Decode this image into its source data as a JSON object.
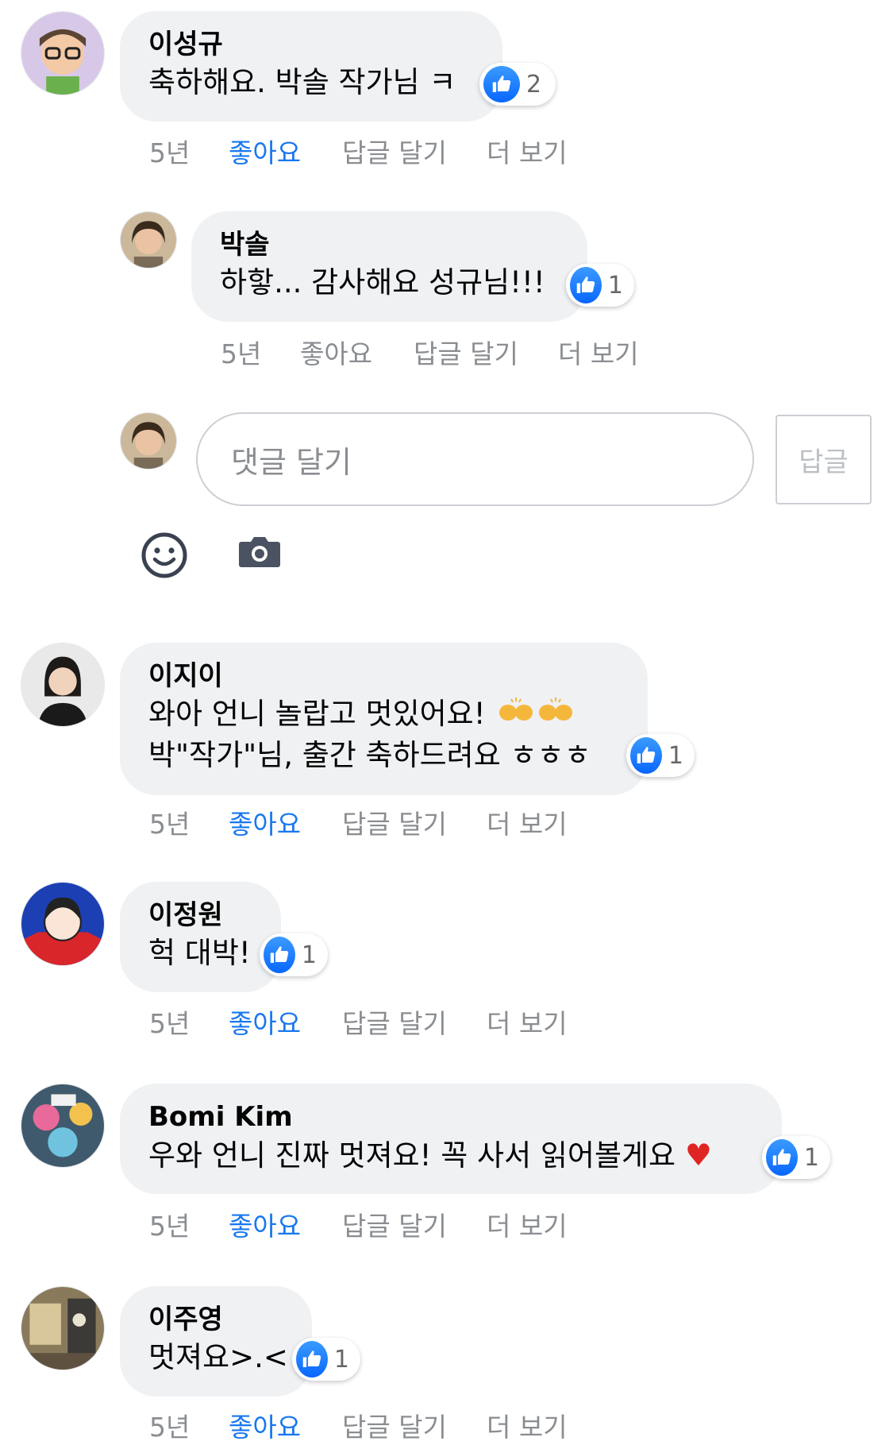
{
  "colors": {
    "accent": "#1877f2",
    "bubble": "#eff1f3",
    "muted": "#8a8d91"
  },
  "comments": [
    {
      "author": "이성규",
      "text": "축하해요. 박솔 작가님 ㅋ",
      "reaction_count": "2",
      "time": "5년",
      "like": "좋아요",
      "reply": "답글 달기",
      "more": "더 보기",
      "liked": true
    },
    {
      "author": "박솔",
      "text": "하핳... 감사해요 성규님!!!",
      "reaction_count": "1",
      "time": "5년",
      "like": "좋아요",
      "reply": "답글 달기",
      "more": "더 보기",
      "liked": false
    },
    {
      "author": "이지이",
      "text_line1": "와아 언니 놀랍고 멋있어요!",
      "text_line2": "박\"작가\"님, 출간 축하드려요 ㅎㅎㅎ",
      "emoji": "raising-hands-icon",
      "reaction_count": "1",
      "time": "5년",
      "like": "좋아요",
      "reply": "답글 달기",
      "more": "더 보기",
      "liked": true
    },
    {
      "author": "이정원",
      "text": "헉 대박!",
      "reaction_count": "1",
      "time": "5년",
      "like": "좋아요",
      "reply": "답글 달기",
      "more": "더 보기",
      "liked": true
    },
    {
      "author": "Bomi Kim",
      "text": "우와 언니 진짜 멋져요! 꼭 사서 읽어볼게요",
      "heart": "♥",
      "reaction_count": "1",
      "time": "5년",
      "like": "좋아요",
      "reply": "답글 달기",
      "more": "더 보기",
      "liked": true
    },
    {
      "author": "이주영",
      "text": "멋져요>.<",
      "reaction_count": "1",
      "time": "5년",
      "like": "좋아요",
      "reply": "답글 달기",
      "more": "더 보기",
      "liked": true
    }
  ],
  "reply_box": {
    "placeholder": "댓글 달기",
    "submit": "답글"
  },
  "tools": {
    "emoji": "smiley-icon",
    "camera": "camera-icon"
  }
}
